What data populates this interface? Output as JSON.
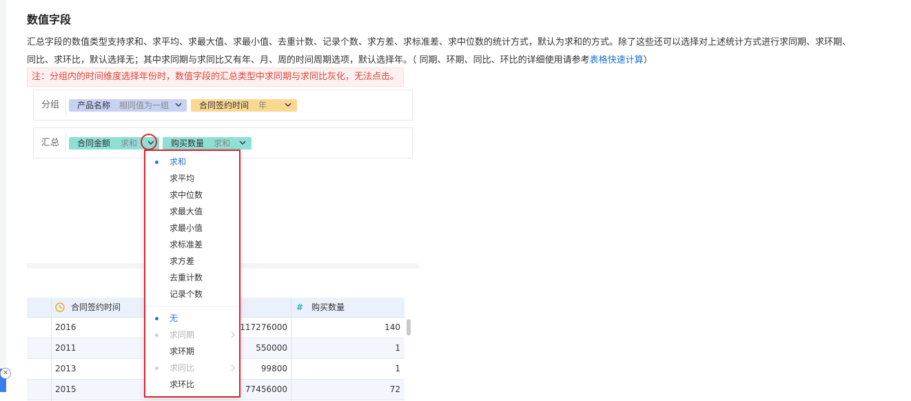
{
  "title": "数值字段",
  "description": {
    "line1": "汇总字段的数值类型支持求和、求平均、求最大值、求最小值、去重计数、记录个数、求方差、求标准差、求中位数的统计方式，默认为求和的方式。除了这些还可以选择对上述统计方式进行求同期、求环期、",
    "line2_pre": "同比、求环比，默认选择无；其中求同期与求同比又有年、月、周的时间周期选项，默认选择年。（ 同期、环期、同比、环比的详细使用请参考",
    "link": "表格快速计算",
    "line2_post": "）"
  },
  "note": "注：分组内的时间维度选择年份时，数值字段的汇总类型中求同期与求同比灰化，无法点击。",
  "group_panel": {
    "label": "分组",
    "chips": [
      {
        "name": "产品名称",
        "agg": "相同值为一组"
      },
      {
        "name": "合同签约时间",
        "agg": "年"
      }
    ]
  },
  "summary_panel": {
    "label": "汇总",
    "chips": [
      {
        "name": "合同金额",
        "agg": "求和"
      },
      {
        "name": "购买数量",
        "agg": "求和"
      }
    ]
  },
  "dropdown": {
    "stat_options": [
      "求和",
      "求平均",
      "求中位数",
      "求最大值",
      "求最小值",
      "求标准差",
      "求方差",
      "去重计数",
      "记录个数"
    ],
    "selected_stat": "求和",
    "period_options": [
      "无",
      "求同期",
      "求环期",
      "求同比",
      "求环比"
    ],
    "selected_period": "无",
    "disabled_periods": [
      "求同期",
      "求同比"
    ]
  },
  "table": {
    "headers": {
      "time": "合同签约时间",
      "qty": "购买数量"
    },
    "rows": [
      {
        "time": "2016",
        "amount": "117276000",
        "qty": "140"
      },
      {
        "time": "2011",
        "amount": "550000",
        "qty": "1"
      },
      {
        "time": "2013",
        "amount": "99800",
        "qty": "1"
      },
      {
        "time": "2015",
        "amount": "77456000",
        "qty": "72"
      }
    ]
  },
  "colors": {
    "accent": "#2f6fe0",
    "highlight": "#e0202e",
    "chip_purple": "#c7d2f2",
    "chip_orange": "#fbd891",
    "chip_teal": "#8fe0d4"
  }
}
